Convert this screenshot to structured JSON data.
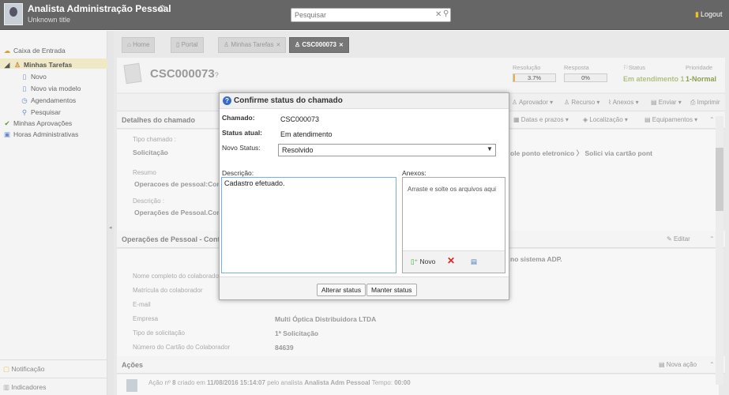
{
  "header": {
    "app_title": "Analista Administração Pessoal",
    "subtitle": "Unknown title",
    "search_placeholder": "Pesquisar",
    "logout_label": "Logout"
  },
  "sidebar": {
    "items": [
      {
        "label": "Caixa de Entrada",
        "icon": "inbox-icon"
      },
      {
        "label": "Minhas Tarefas",
        "icon": "user-tasks-icon"
      },
      {
        "label": "Novo",
        "icon": "new-doc-icon"
      },
      {
        "label": "Novo via modelo",
        "icon": "template-icon"
      },
      {
        "label": "Agendamentos",
        "icon": "clock-icon"
      },
      {
        "label": "Pesquisar",
        "icon": "search-icon"
      },
      {
        "label": "Minhas Aprovações",
        "icon": "check-icon"
      },
      {
        "label": "Horas Administrativas",
        "icon": "hours-icon"
      }
    ],
    "bottom": [
      {
        "label": "Notificação"
      },
      {
        "label": "Indicadores"
      }
    ]
  },
  "tabs": [
    {
      "label": "Home"
    },
    {
      "label": "Portal"
    },
    {
      "label": "Minhas Tarefas"
    },
    {
      "label": "CSC000073"
    }
  ],
  "ticket": {
    "id": "CSC000073",
    "id_suffix": "?",
    "kpis": {
      "resolucao_label": "Resolução",
      "resolucao_value": "3.7%",
      "resolucao_fraction": 0.037,
      "resposta_label": "Resposta",
      "resposta_value": "0%",
      "status_label": "Status",
      "status_value": "Em atendimento 1",
      "prioridade_label": "Prioridade",
      "prioridade_value": "1-Normal"
    },
    "toolbar": [
      "Aprovador",
      "Recurso",
      "Anexos",
      "Enviar",
      "Imprimir"
    ],
    "section_toolbar": [
      "Datas e prazos",
      "Localização",
      "Equipamentos"
    ],
    "details_title": "Detalhes do chamado",
    "tipo_label": "Tipo chamado :",
    "tipo_value": "Solicitação",
    "breadcrumb_tail": [
      "ole ponto eletronico",
      "Solici via cartão pont"
    ],
    "resumo_label": "Resumo",
    "resumo_value": "Operacoes de pessoal:Contr",
    "descricao_label": "Descrição :",
    "descricao_value": "Operações de Pessoal.Contr",
    "ops_title": "Operações de Pessoal - Contr",
    "ops_text_tail": "no sistema ADP.",
    "edit_label": "Editar",
    "fields": [
      {
        "label": "Nome completo do colaborador",
        "value": ""
      },
      {
        "label": "Matrícula do colaborador",
        "value": ""
      },
      {
        "label": "E-mail",
        "value": ""
      },
      {
        "label": "Empresa",
        "value": "Multi Óptica Distribuidora LTDA"
      },
      {
        "label": "Tipo de solicitação",
        "value": "1ª Solicitação"
      },
      {
        "label": "Número do Cartão do Colaborador",
        "value": "84639"
      }
    ],
    "acoes_title": "Ações",
    "nova_acao_label": "Nova ação",
    "action": {
      "prefix": "Ação nº",
      "number": "8",
      "created": "criado em",
      "date": "11/08/2016 15:14:07",
      "by": "pelo analista",
      "analyst": "Analista Adm Pessoal",
      "time_label": "Tempo:",
      "time_value": "00:00"
    }
  },
  "modal": {
    "title": "Confirme status do chamado",
    "chamado_label": "Chamado:",
    "chamado_value": "CSC000073",
    "status_atual_label": "Status atual:",
    "status_atual_value": "Em atendimento",
    "novo_status_label": "Novo Status:",
    "novo_status_value": "Resolvido",
    "descricao_label": "Descrição:",
    "descricao_value": "Cadastro efetuado.",
    "anexos_label": "Anexos:",
    "anexos_hint": "Arraste e solte os arquivos aqui",
    "novo_label": "Novo",
    "alterar_label": "Alterar status",
    "manter_label": "Manter status"
  },
  "colors": {
    "topbar": "#666666",
    "accent_blue": "#3a6ac8",
    "progress_fill": "#e8b040",
    "status_green": "#b0c080"
  }
}
